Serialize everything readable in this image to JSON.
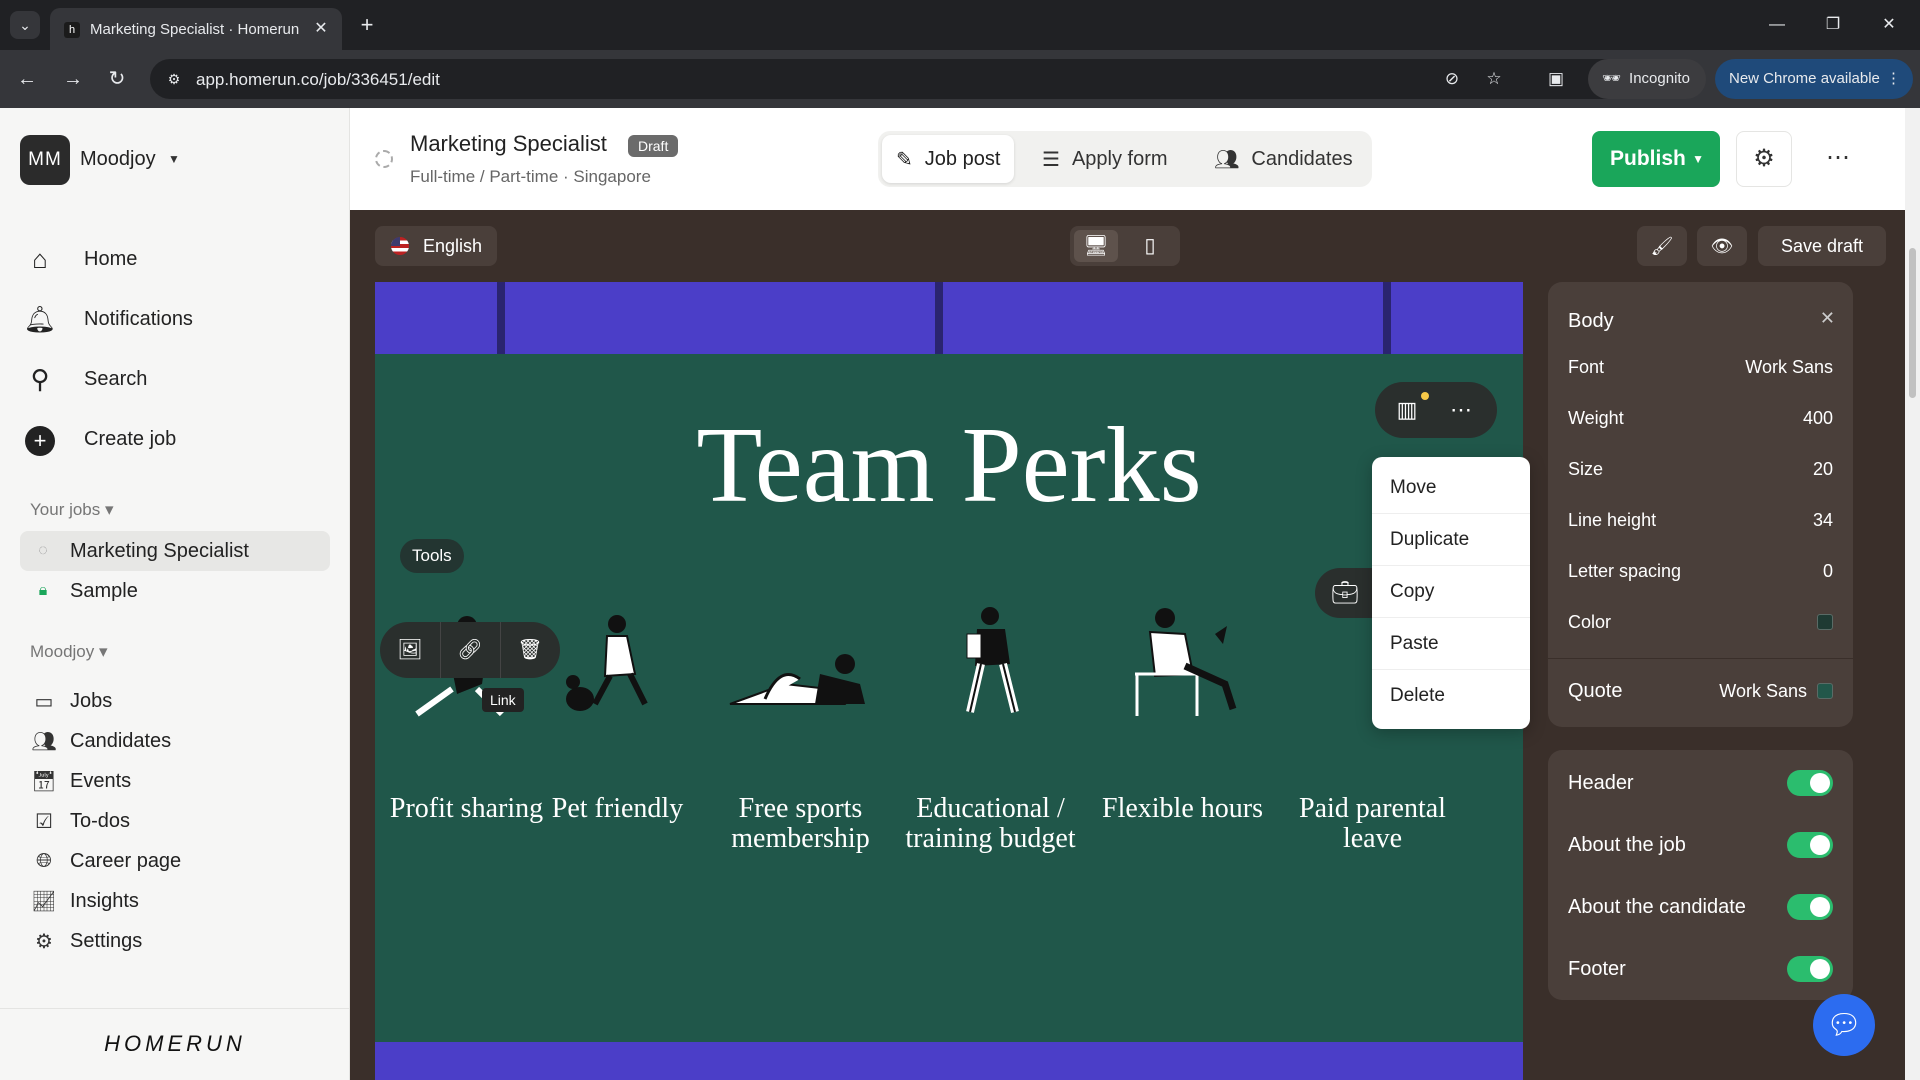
{
  "browser": {
    "tab_title": "Marketing Specialist · Homerun",
    "url": "app.homerun.co/job/336451/edit",
    "incognito_label": "Incognito",
    "update_label": "New Chrome available"
  },
  "sidebar": {
    "workspace_initials": "MM",
    "workspace_name": "Moodjoy",
    "nav": [
      {
        "label": "Home",
        "icon": "home-icon"
      },
      {
        "label": "Notifications",
        "icon": "bell-icon"
      },
      {
        "label": "Search",
        "icon": "search-icon"
      },
      {
        "label": "Create job",
        "icon": "plus-icon"
      }
    ],
    "your_jobs_label": "Your jobs",
    "jobs": [
      {
        "label": "Marketing Specialist",
        "active": true
      },
      {
        "label": "Sample",
        "active": false
      }
    ],
    "org_label": "Moodjoy",
    "org_items": [
      {
        "label": "Jobs",
        "icon": "calendar-icon"
      },
      {
        "label": "Candidates",
        "icon": "people-icon"
      },
      {
        "label": "Events",
        "icon": "calendar-icon"
      },
      {
        "label": "To-dos",
        "icon": "checkbox-icon"
      },
      {
        "label": "Career page",
        "icon": "globe-icon"
      },
      {
        "label": "Insights",
        "icon": "chart-icon"
      },
      {
        "label": "Settings",
        "icon": "gear-icon"
      }
    ],
    "brand": "HOMERUN"
  },
  "header": {
    "job_title": "Marketing Specialist",
    "status_badge": "Draft",
    "meta": "Full-time / Part-time · Singapore",
    "tabs": [
      {
        "label": "Job post",
        "icon": "pencil-icon",
        "active": true
      },
      {
        "label": "Apply form",
        "icon": "checklist-icon",
        "active": false
      },
      {
        "label": "Candidates",
        "icon": "people-icon",
        "active": false
      }
    ],
    "publish_label": "Publish"
  },
  "editor": {
    "language": "English",
    "save_draft_label": "Save draft"
  },
  "canvas": {
    "section_title": "Team Perks",
    "tools_label": "Tools",
    "link_tooltip": "Link",
    "perks": [
      "Profit sharing",
      "Pet friendly",
      "Free sports membership",
      "Educational / training budget",
      "Flexible hours",
      "Paid parental leave"
    ],
    "context_menu": [
      "Move",
      "Duplicate",
      "Copy",
      "Paste",
      "Delete"
    ]
  },
  "style_panel": {
    "body_title": "Body",
    "rows": [
      {
        "label": "Font",
        "value": "Work Sans"
      },
      {
        "label": "Weight",
        "value": "400"
      },
      {
        "label": "Size",
        "value": "20"
      },
      {
        "label": "Line height",
        "value": "34"
      },
      {
        "label": "Letter spacing",
        "value": "0"
      },
      {
        "label": "Color",
        "value": ""
      }
    ],
    "quote_label": "Quote",
    "quote_font": "Work Sans",
    "colors": {
      "body": "#1f3a33",
      "quote": "#22574a",
      "toggle_on": "#2bbd6e",
      "publish": "#1aa65a"
    }
  },
  "sections_panel": {
    "toggles": [
      {
        "label": "Header",
        "on": true
      },
      {
        "label": "About the job",
        "on": true
      },
      {
        "label": "About the candidate",
        "on": true
      },
      {
        "label": "Footer",
        "on": true
      }
    ]
  }
}
